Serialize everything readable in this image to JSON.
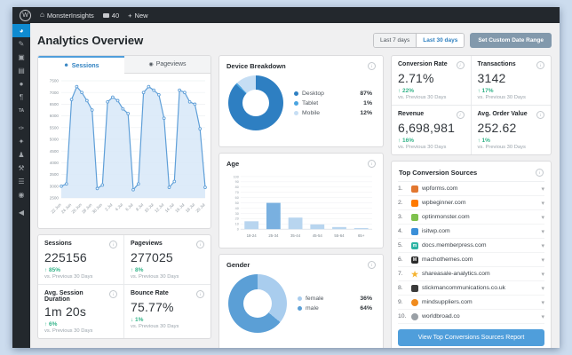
{
  "colors": {
    "admin_dark": "#23282d",
    "active_menu_blue": "#0f8bd1",
    "accent_blue": "#4f9edb",
    "link_blue": "#2e80c0",
    "positive_green": "#35b48a",
    "custom_btn_slate": "#8299ac"
  },
  "admin_bar": {
    "wp_logo": "W",
    "home_icon": "⌂",
    "site_name": "MonsterInsights",
    "comments_count": "40",
    "plus": "+",
    "new_label": "New"
  },
  "sidebar": {
    "items": [
      {
        "name": "dashboard",
        "glyph": "◕",
        "active": true
      },
      {
        "name": "posts",
        "glyph": "✎"
      },
      {
        "name": "media",
        "glyph": "▣"
      },
      {
        "name": "pages",
        "glyph": "▤"
      },
      {
        "name": "comments",
        "glyph": "●"
      },
      {
        "name": "forms",
        "glyph": "¶"
      },
      {
        "name": "ta-plugin",
        "glyph": "TA",
        "text": true
      },
      {
        "name": "appearance",
        "glyph": "✑",
        "gap": true
      },
      {
        "name": "plugins",
        "glyph": "✦"
      },
      {
        "name": "users",
        "glyph": "♟"
      },
      {
        "name": "tools",
        "glyph": "⚒"
      },
      {
        "name": "settings",
        "glyph": "☰"
      },
      {
        "name": "monsterinsights",
        "glyph": "◉"
      },
      {
        "name": "collapse",
        "glyph": "◀",
        "gap": true
      }
    ]
  },
  "header": {
    "title": "Analytics Overview",
    "range_7": "Last 7 days",
    "range_30": "Last 30 days",
    "custom_range": "Set Custom Date Range"
  },
  "tabs": {
    "sessions": "Sessions",
    "pageviews": "Pageviews"
  },
  "stats_left": [
    {
      "label": "Sessions",
      "value": "225156",
      "direction": "up",
      "change": "85%",
      "sub": "vs. Previous 30 Days"
    },
    {
      "label": "Pageviews",
      "value": "277025",
      "direction": "up",
      "change": "8%",
      "sub": "vs. Previous 30 Days"
    },
    {
      "label": "Avg. Session Duration",
      "value": "1m 20s",
      "direction": "up",
      "change": "6%",
      "sub": "vs. Previous 30 Days"
    },
    {
      "label": "Bounce Rate",
      "value": "75.77%",
      "direction": "down",
      "change": "1%",
      "sub": "vs. Previous 30 Days"
    }
  ],
  "stats_right": [
    {
      "label": "Conversion Rate",
      "value": "2.71%",
      "direction": "up",
      "change": "22%",
      "sub": "vs. Previous 30 Days"
    },
    {
      "label": "Transactions",
      "value": "3142",
      "direction": "up",
      "change": "17%",
      "sub": "vs. Previous 30 Days"
    },
    {
      "label": "Revenue",
      "value": "6,698,981",
      "direction": "up",
      "change": "16%",
      "sub": "vs. Previous 30 Days"
    },
    {
      "label": "Avg. Order Value",
      "value": "252.62",
      "direction": "up",
      "change": "1%",
      "sub": "vs. Previous 30 Days"
    }
  ],
  "top_sources": {
    "title": "Top Conversion Sources",
    "button_label": "View Top Conversions Sources Report",
    "items": [
      {
        "rank": "1.",
        "domain": "wpforms.com",
        "icon_color": "#e27730",
        "shape": "square"
      },
      {
        "rank": "2.",
        "domain": "wpbeginner.com",
        "icon_color": "#ff7a00",
        "shape": "square"
      },
      {
        "rank": "3.",
        "domain": "optinmonster.com",
        "icon_color": "#7ec14d",
        "shape": "square"
      },
      {
        "rank": "4.",
        "domain": "isitwp.com",
        "icon_color": "#3a8fd8",
        "shape": "square"
      },
      {
        "rank": "5.",
        "domain": "docs.memberpress.com",
        "icon_color": "#2bb3a3",
        "shape": "square",
        "glyph": "m"
      },
      {
        "rank": "6.",
        "domain": "machothemes.com",
        "icon_color": "#2b2b2b",
        "shape": "square",
        "glyph": "M"
      },
      {
        "rank": "7.",
        "domain": "shareasale-analytics.com",
        "icon_color": "#f5b32f",
        "shape": "star",
        "glyph": "★"
      },
      {
        "rank": "8.",
        "domain": "stickmancommunications.co.uk",
        "icon_color": "#3a3a3a",
        "shape": "square"
      },
      {
        "rank": "9.",
        "domain": "mindsuppliers.com",
        "icon_color": "#f08b1d",
        "shape": "circle"
      },
      {
        "rank": "10.",
        "domain": "worldbroad.co",
        "icon_color": "#9aa0a6",
        "shape": "circle"
      }
    ]
  },
  "chart_data": [
    {
      "id": "sessions",
      "type": "line",
      "title": "Sessions",
      "x_tick_labels": [
        "22 Jun",
        "24 Jun",
        "26 Jun",
        "28 Jun",
        "30 Jun",
        "2 Jul",
        "4 Jul",
        "6 Jul",
        "8 Jul",
        "10 Jul",
        "12 Jul",
        "14 Jul",
        "16 Jul",
        "18 Jul",
        "20 Jul"
      ],
      "values": [
        3000,
        3100,
        6700,
        7250,
        7000,
        6650,
        6250,
        2900,
        3050,
        6600,
        6800,
        6650,
        6300,
        6100,
        2850,
        3100,
        7000,
        7250,
        7100,
        6900,
        5900,
        2950,
        3200,
        7100,
        7000,
        6600,
        6500,
        5450,
        2950
      ],
      "ylim": [
        2500,
        7500
      ],
      "y_step": 500,
      "grid": true,
      "line_color": "#5f9fd8",
      "fill_color": "#d9e9f8"
    },
    {
      "id": "device_breakdown",
      "type": "pie",
      "title": "Device Breakdown",
      "labels": [
        "Desktop",
        "Tablet",
        "Mobile"
      ],
      "values": [
        87,
        1,
        12
      ],
      "display_values": [
        "87%",
        "1%",
        "12%"
      ],
      "colors": [
        "#2e7fc2",
        "#4aa4e0",
        "#c6def4"
      ],
      "legend_position": "right"
    },
    {
      "id": "age",
      "type": "bar",
      "title": "Age",
      "categories": [
        "18-24",
        "25-34",
        "35-44",
        "45-54",
        "55-64",
        "65+"
      ],
      "values": [
        15,
        50,
        22,
        9,
        4,
        2
      ],
      "ylim": [
        0,
        100
      ],
      "y_step": 10,
      "grid": true,
      "bar_color": "#b8d5ef",
      "highlight_index": 1,
      "highlight_color": "#79b0e0"
    },
    {
      "id": "gender",
      "type": "pie",
      "title": "Gender",
      "labels": [
        "female",
        "male"
      ],
      "values": [
        36,
        64
      ],
      "display_values": [
        "36%",
        "64%"
      ],
      "colors": [
        "#a9cdee",
        "#5b9fd6"
      ],
      "legend_position": "right"
    }
  ]
}
